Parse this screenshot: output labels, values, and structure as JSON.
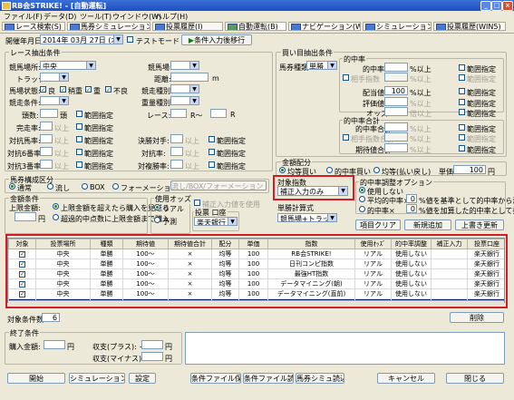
{
  "window": {
    "title": "RB会STRIKE! - [自動運転]"
  },
  "menu": [
    "ファイル(F)",
    "データ(D)",
    "ツール(T)",
    "ウインドウ(W)",
    "ヘルプ(H)"
  ],
  "tabs": [
    "レース検索(S)",
    "馬券シミュレーション(E)",
    "投票履歴(I)",
    "自動運転(B)",
    "ナビゲーション(WIN5)",
    "シミュレーション(WIN5)",
    "投票履歴(WIN5)"
  ],
  "header": {
    "date_label": "開催年月日:",
    "date_value": "2014年 03月 27日 (木)",
    "test_mode": "テストモード",
    "load_button": "条件入力後移行"
  },
  "race": {
    "title": "レース抽出条件",
    "venue_label": "競馬場所:",
    "venue_value": "中央",
    "racecourse_label": "競馬場:",
    "track_label": "トラック:",
    "distance_label": "距離:",
    "distance_unit": "m",
    "range": "範囲指定",
    "condition_label": "馬場状態:",
    "conditions": [
      "良",
      "稍重",
      "重",
      "不良"
    ],
    "class_label": "競走条件:",
    "horse_type_label": "競走種別:",
    "weight_label": "重量種別:",
    "heads_label": "頭数:",
    "heads_unit": "頭",
    "race_label": "レース:",
    "race_r": "R〜",
    "race_r2": "R",
    "odds_rows": [
      {
        "label": "完走率:",
        "unit": "以上"
      },
      {
        "label": "対抗馬率:",
        "unit": "以上"
      },
      {
        "label": "対抗6番率:",
        "unit": "以上"
      },
      {
        "label": "対抗3番率:",
        "unit": "以上"
      }
    ],
    "mid_rows": [
      {
        "label": "決勝対手:"
      },
      {
        "label": "対抗率:"
      },
      {
        "label": "対複勝率:"
      }
    ],
    "range_labels": [
      "範囲指定",
      "範囲指定",
      "範囲指定",
      "範囲指定"
    ],
    "unit_above": "以上"
  },
  "buy": {
    "title": "買い目抽出条件",
    "type_label": "馬券種類:",
    "type_value": "単勝",
    "hit_title": "的中率",
    "hit_label": "的中率:",
    "hit_unit": "%以上",
    "axis_label": "相手指数",
    "axis_unit": "%以上",
    "payout_label": "配当値:",
    "payout_value": "100",
    "payout_unit": "%以上",
    "eval_label": "評価値:",
    "eval_unit": "%以上",
    "odds_label": "オッズ:",
    "odds_unit": "倍以上",
    "sum_title": "的中率合計",
    "sum_label": "的中率合計:",
    "sum_unit": "%以上",
    "sum_axis": "相手指数合計",
    "sum_axis_unit": "%以上",
    "expect_label": "期待値合計:",
    "expect_unit": "%以上",
    "range": "範囲指定"
  },
  "allocation": {
    "title": "金額配分",
    "options": [
      "均等買い",
      "的中率買い",
      "均等(払い戻し)"
    ],
    "unit_label": "単価:",
    "unit_value": "100",
    "unit_yen": "円"
  },
  "method": {
    "title": "馬券構成区分",
    "options": [
      "通常",
      "流し",
      "BOX",
      "フォーメーション"
    ],
    "box_button": "流し/BOX/フォーメーション 対象馬の指定"
  },
  "money": {
    "title": "金額条件",
    "limit_label": "上限金額:",
    "limit_unit": "円",
    "opt1": "上限金額を超えたら購入を見送る",
    "opt2": "超過的中点数に上限金額まで購入",
    "odds_title": "使用オッズ",
    "odds_options": [
      "リアル",
      "予測"
    ],
    "enter_check": "補正入力値を使用",
    "vote_title": "投票 口座",
    "vote_value": "楽天銀行"
  },
  "target": {
    "title": "対象指数",
    "value": "補正入力のみ",
    "calc_title": "単勝計算式",
    "calc_value": "競馬場+トラック別"
  },
  "adjust": {
    "title": "的中率調整オプション",
    "opt1": "使用しない",
    "opt2": "平均的中率×",
    "opt2_value": "0",
    "opt2_tail": "%値を基準として的中率から減算",
    "opt3": "的中率×",
    "opt3_value": "0",
    "opt3_tail": "%値を加算した的中率として扱う"
  },
  "buttons": {
    "clear": "項目クリア",
    "add": "新規追加",
    "update": "上書き更新",
    "delete": "削除"
  },
  "grid": {
    "headers": [
      "対象",
      "投票場所",
      "種類",
      "期待値",
      "期待値合計",
      "配分",
      "単価",
      "指数",
      "使用ｵｯｽﾞ",
      "的中率調整",
      "補正入力",
      "投票口座"
    ],
    "rows": [
      [
        "",
        "中央",
        "単勝",
        "100〜",
        "×",
        "均等",
        "100",
        "RB会STRIKE!",
        "リアル",
        "使用しない",
        "",
        "楽天銀行"
      ],
      [
        "",
        "中央",
        "単勝",
        "100〜",
        "×",
        "均等",
        "100",
        "日刊コンピ指数",
        "リアル",
        "使用しない",
        "",
        "楽天銀行"
      ],
      [
        "",
        "中央",
        "単勝",
        "100〜",
        "×",
        "均等",
        "100",
        "最強HT指数",
        "リアル",
        "使用しない",
        "",
        "楽天銀行"
      ],
      [
        "",
        "中央",
        "単勝",
        "100〜",
        "×",
        "均等",
        "100",
        "データマイニング(朝)",
        "リアル",
        "使用しない",
        "",
        "楽天銀行"
      ],
      [
        "",
        "中央",
        "単勝",
        "100〜",
        "×",
        "均等",
        "100",
        "データマイニング(直前)",
        "リアル",
        "使用しない",
        "",
        "楽天銀行"
      ],
      [
        "",
        "中央",
        "単勝",
        "100〜",
        "×",
        "均等",
        "100",
        "補正入力のみ",
        "リアル",
        "使用しない",
        "-",
        "楽天銀行"
      ]
    ],
    "checked": [
      true,
      true,
      true,
      true,
      true,
      true
    ],
    "selected_row": 5
  },
  "count": {
    "label": "対象条件数:",
    "value": "6"
  },
  "end": {
    "title": "終了条件",
    "buy_label": "購入金額:",
    "buy_unit": "円",
    "plus_label": "収支(プラス): +",
    "plus_unit": "円",
    "minus_label": "収支(マイナス): -",
    "minus_unit": "円"
  },
  "footer": [
    "開始",
    "シミュレーション",
    "設定",
    "条件ファイル保存",
    "条件ファイル読込",
    "馬券シミュ読込"
  ],
  "footer_right": [
    "キャンセル",
    "閉じる"
  ]
}
